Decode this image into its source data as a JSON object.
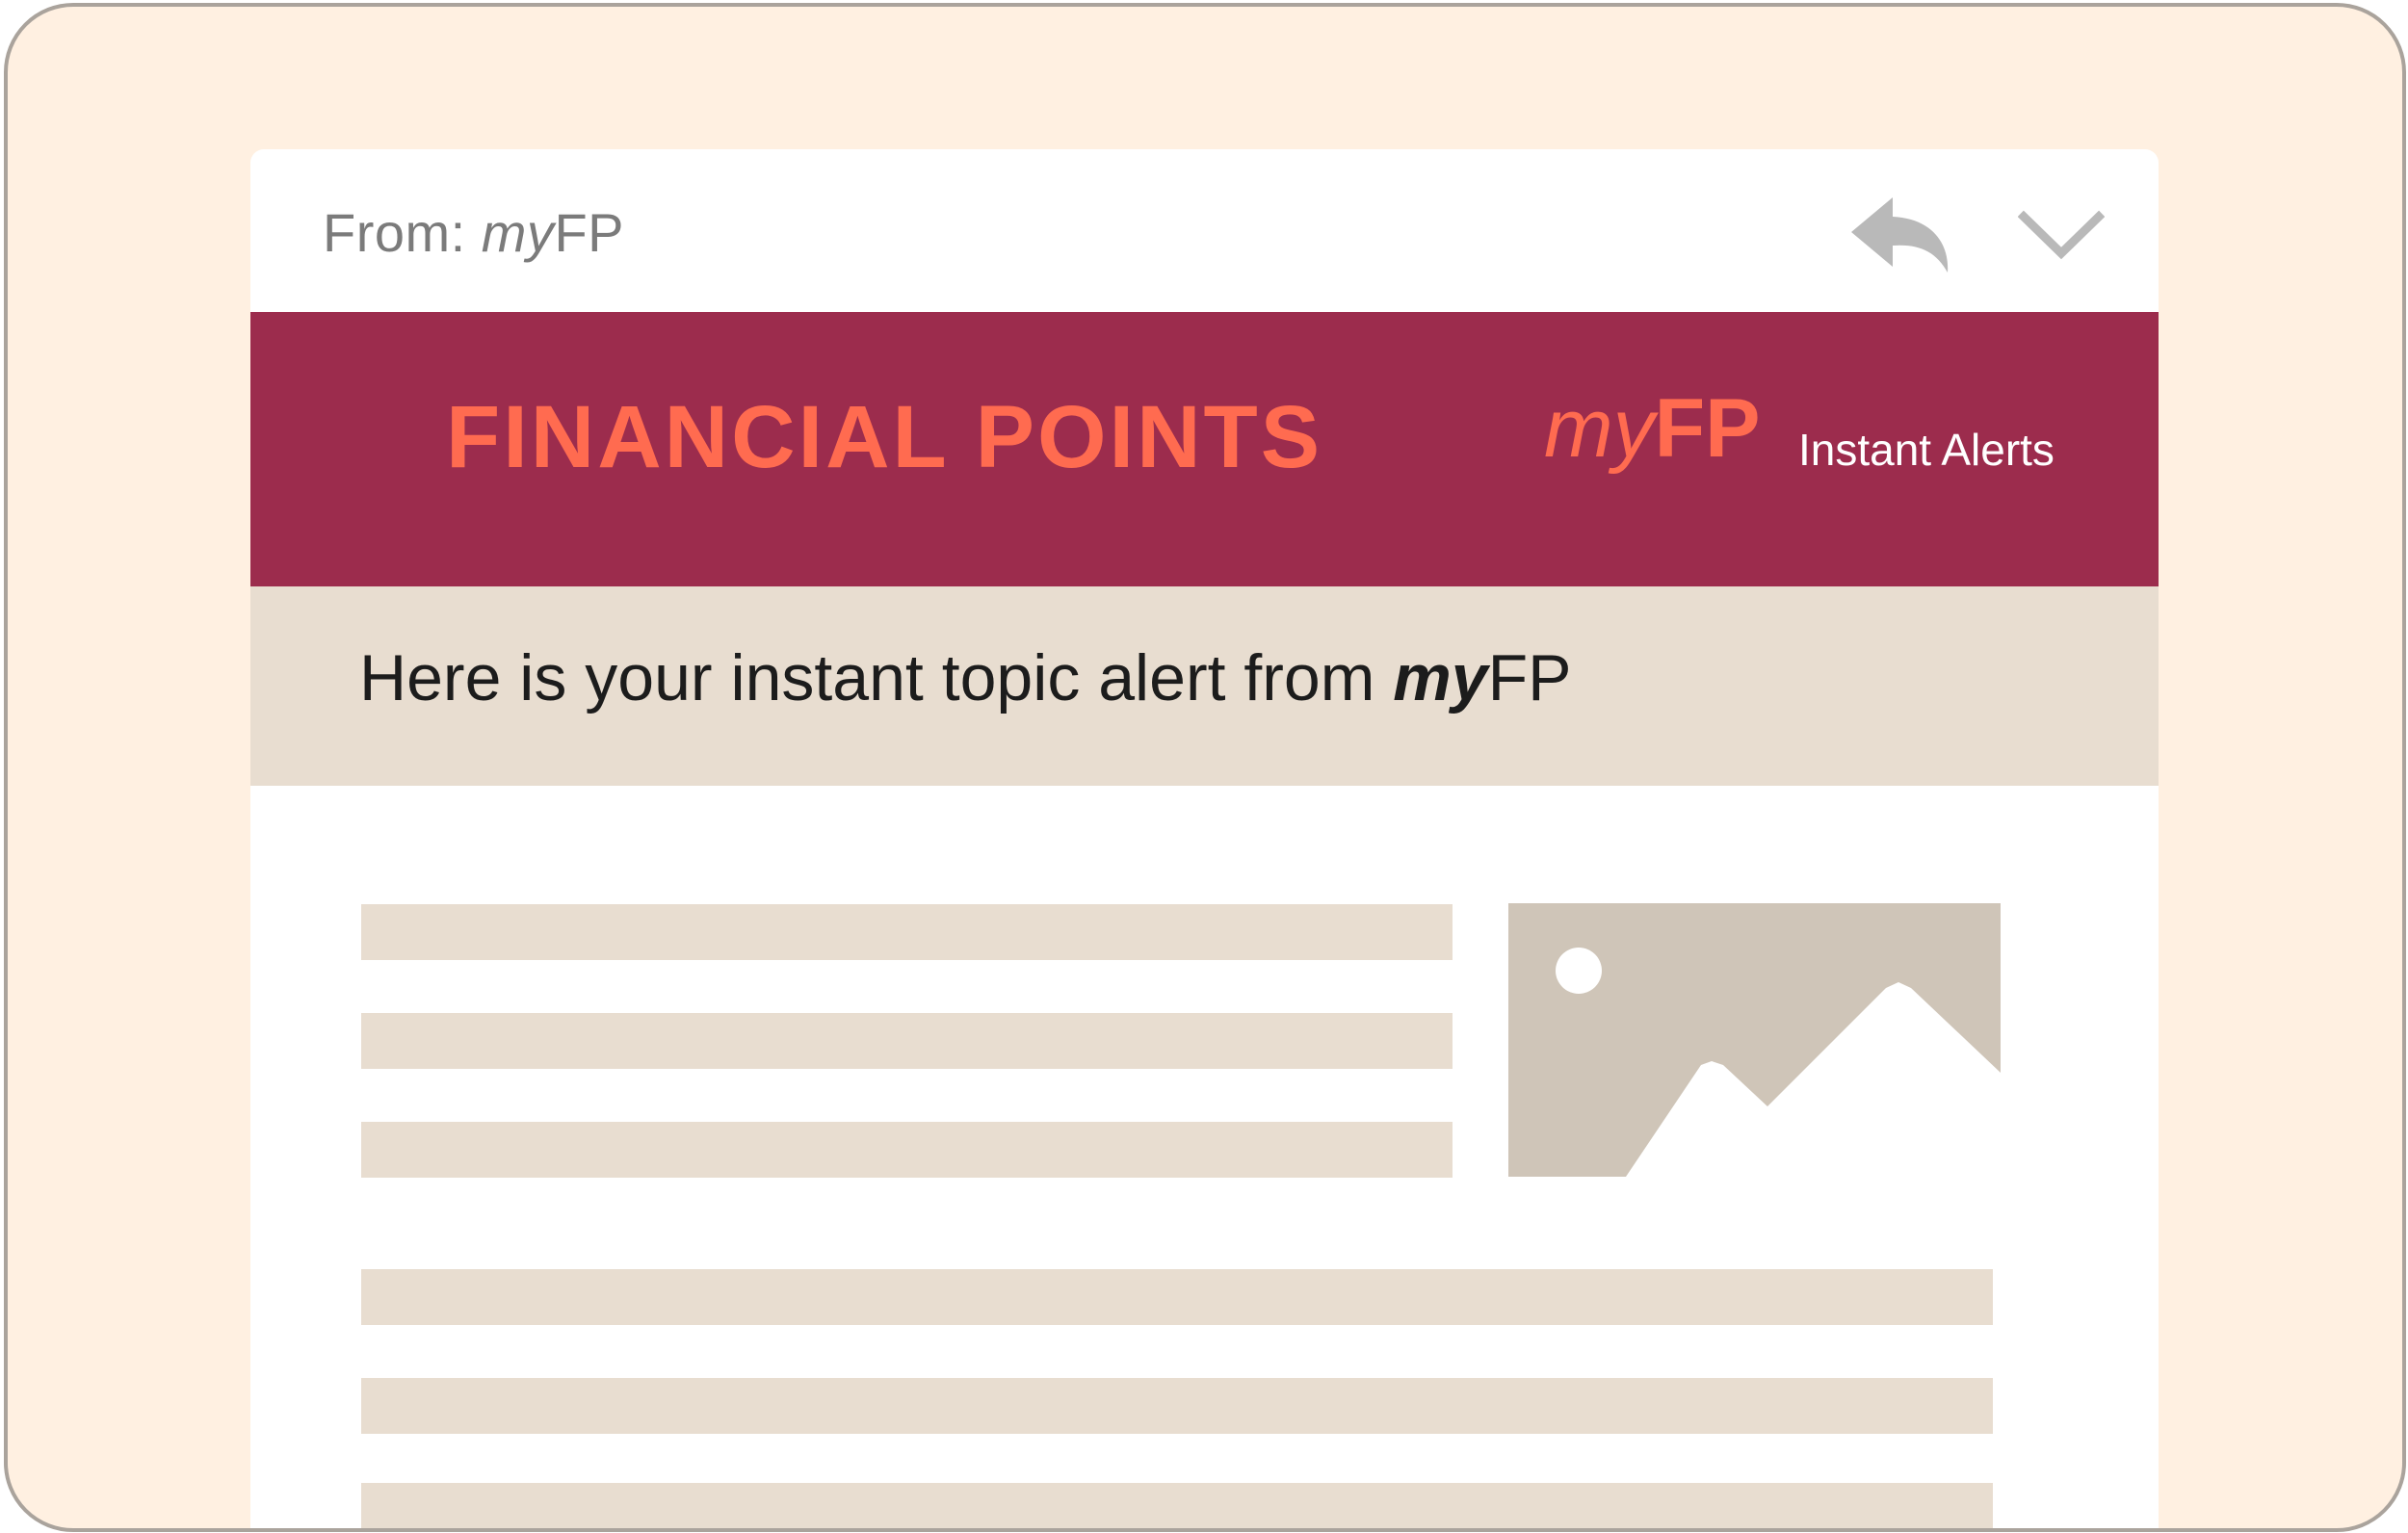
{
  "email": {
    "from_label": "From:",
    "sender_my": "my",
    "sender_fp": "FP",
    "reply_icon": "reply-arrow-icon",
    "more_icon": "chevron-down-icon"
  },
  "banner": {
    "title": "FINANCIAL POINTS",
    "logo_my": "my",
    "logo_fp": "FP",
    "tagline": "Instant Alerts"
  },
  "intro": {
    "text": "Here is your instant topic alert from ",
    "brand_my": "my",
    "brand_fp": "FP"
  },
  "placeholder_image_icon": "image-placeholder-icon",
  "colors": {
    "background": "#fff0e1",
    "banner": "#9c2c4d",
    "accent": "#ff6b50",
    "placeholder": "#e8ddd0",
    "image_placeholder": "#cfc5b8"
  }
}
